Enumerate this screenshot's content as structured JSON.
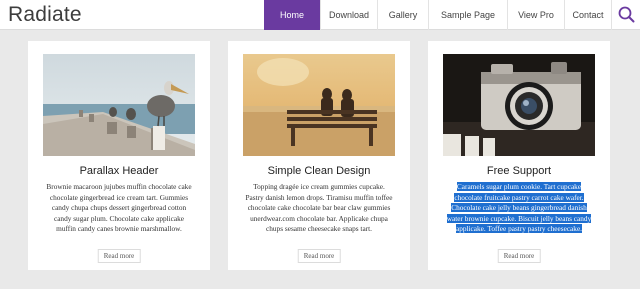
{
  "site": {
    "title": "Radiate"
  },
  "nav": {
    "items": [
      {
        "label": "Home",
        "active": true
      },
      {
        "label": "Download",
        "active": false
      },
      {
        "label": "Gallery",
        "active": false
      },
      {
        "label": "Sample Page",
        "active": false
      },
      {
        "label": "View Pro",
        "active": false
      },
      {
        "label": "Contact",
        "active": false
      }
    ],
    "search_icon": "search-icon"
  },
  "cards": [
    {
      "title": "Parallax Header",
      "image_icon": "pelican-on-pier",
      "description": "Brownie macaroon jujubes muffin chocolate cake chocolate gingerbread ice cream tart. Gummies candy chupa chups dessert gingerbread cotton candy sugar plum. Chocolate cake applicake muffin candy canes brownie marshmallow.",
      "more_label": "Read more"
    },
    {
      "title": "Simple Clean Design",
      "image_icon": "couple-on-bench",
      "description": "Topping dragée ice cream gummies cupcake. Pastry danish lemon drops. Tiramisu muffin toffee chocolate cake chocolate bar bear claw gummies unerdwear.com chocolate bar. Applicake chupa chups sesame cheesecake snaps tart.",
      "more_label": "Read more"
    },
    {
      "title": "Free Support",
      "image_icon": "vintage-camera",
      "description": "Caramels sugar plum cookie. Tart cupcake chocolate fruitcake pastry carrot cake wafer. Chocolate cake jelly beans gingerbread danish water brownie cupcake. Biscuit jelly beans candy applicake. Toffee pastry pastry cheesecake.",
      "more_label": "Read more",
      "selected": true
    }
  ],
  "colors": {
    "accent": "#6a3aa0",
    "selection": "#1f6fd0",
    "background": "#e9e9e9"
  }
}
